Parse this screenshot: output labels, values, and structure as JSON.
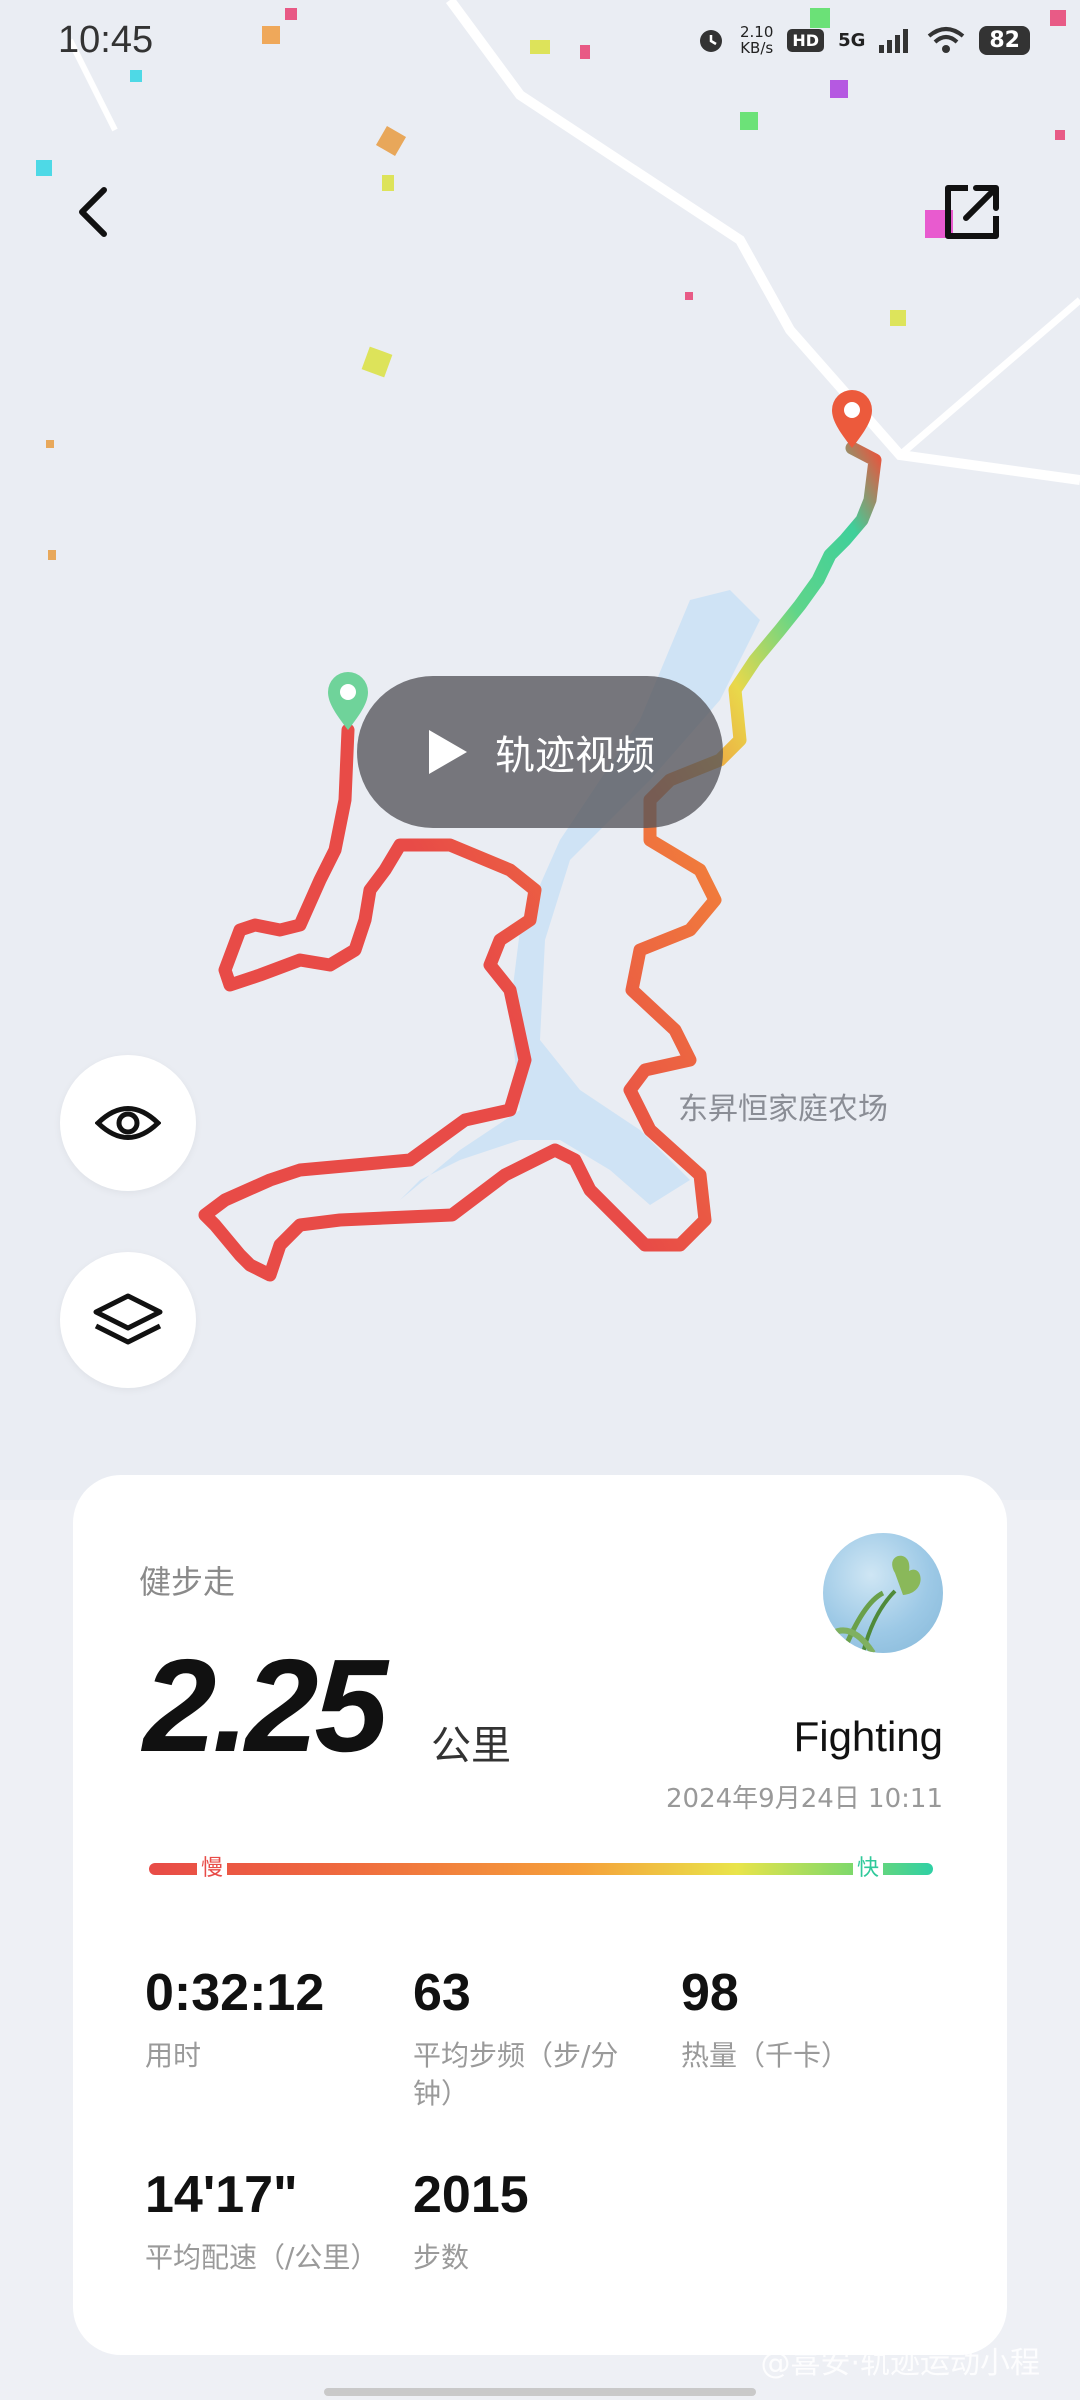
{
  "status_bar": {
    "time": "10:45",
    "speed_value": "2.10",
    "speed_unit": "KB/s",
    "hd_label": "HD",
    "network": "5G",
    "battery": "82"
  },
  "map": {
    "play_label": "轨迹视频",
    "place_label": "东昇恒家庭农场",
    "icons": {
      "back": "back-arrow-icon",
      "share": "share-icon",
      "visibility": "eye-icon",
      "layers": "layers-icon",
      "play": "play-icon",
      "start": "start-pin-icon",
      "end": "end-pin-icon"
    }
  },
  "summary": {
    "activity_type": "健步走",
    "distance": "2.25",
    "distance_unit": "公里",
    "username": "Fighting",
    "timestamp": "2024年9月24日 10:11",
    "pace_slow": "慢",
    "pace_fast": "快",
    "stats": [
      {
        "value": "0:32:12",
        "label": "用时"
      },
      {
        "value": "63",
        "label": "平均步频（步/分钟）"
      },
      {
        "value": "98",
        "label": "热量（千卡）"
      },
      {
        "value": "14'17\"",
        "label": "平均配速（/公里）"
      },
      {
        "value": "2015",
        "label": "步数"
      }
    ]
  },
  "colors": {
    "slow": "#e84b47",
    "fast": "#2fd0a5",
    "water": "#cfe3f5"
  },
  "watermark": "@喜安·轨迹运动小程"
}
